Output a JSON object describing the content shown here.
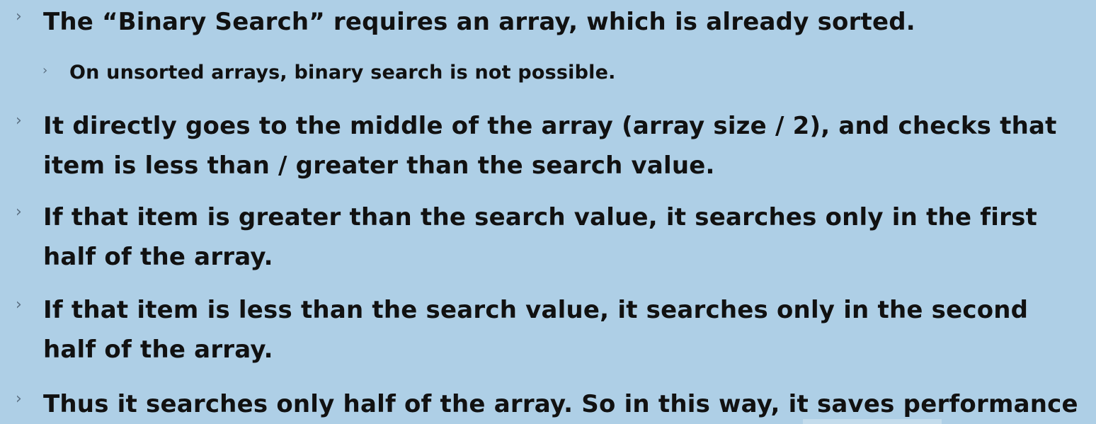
{
  "bullets": [
    {
      "level": 1,
      "lines": [
        "The “Binary Search” requires an array, which is already sorted."
      ]
    },
    {
      "level": 2,
      "lines": [
        "On unsorted arrays, binary search is not possible."
      ]
    },
    {
      "level": 1,
      "lines": [
        "It directly goes to the middle of the array (array size / 2), and checks that",
        "item is less than / greater than the search value."
      ]
    },
    {
      "level": 1,
      "lines": [
        "If that item is greater than the search value, it searches only in the first",
        "half of the array."
      ]
    },
    {
      "level": 1,
      "lines": [
        "If that item is less than the search value, it searches only in the second",
        "half of the array."
      ]
    },
    {
      "level": 1,
      "lines": [
        "Thus it searches only half of the array. So in this way, it saves performance"
      ]
    }
  ],
  "chevron": "›",
  "colors": {
    "background": "#aecfe6",
    "text": "#111111",
    "chevron": "#5a6e80"
  }
}
